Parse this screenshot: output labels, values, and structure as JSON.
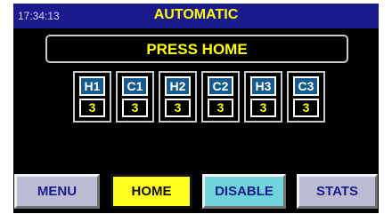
{
  "header": {
    "clock": "17:34:13",
    "mode": "AUTOMATIC"
  },
  "message": "PRESS HOME",
  "stations": [
    {
      "name": "H1",
      "count": "3"
    },
    {
      "name": "C1",
      "count": "3"
    },
    {
      "name": "H2",
      "count": "3"
    },
    {
      "name": "C2",
      "count": "3"
    },
    {
      "name": "H3",
      "count": "3"
    },
    {
      "name": "C3",
      "count": "3"
    }
  ],
  "buttons": {
    "menu": "MENU",
    "home": "HOME",
    "disable": "DISABLE",
    "stats": "STATS"
  },
  "colors": {
    "header_bg": "#1a1a8c",
    "accent_text": "#ffff00",
    "station_name_bg": "#145a8c",
    "home_button_bg": "#ffff20",
    "disable_button_bg": "#70d4dc",
    "nav_button_bg": "#bcbcd4"
  }
}
